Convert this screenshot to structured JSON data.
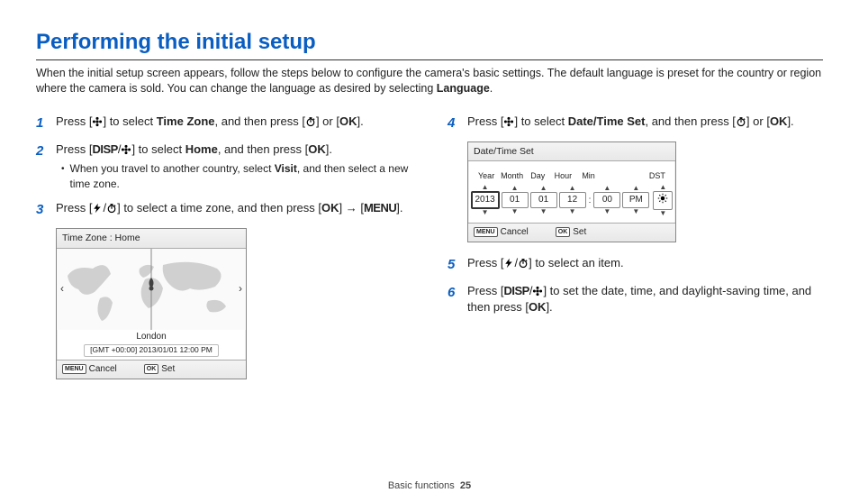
{
  "title": "Performing the initial setup",
  "intro_a": "When the initial setup screen appears, follow the steps below to configure the camera's basic settings. The default language is preset for the country or region where the camera is sold. You can change the language as desired by selecting ",
  "intro_bold": "Language",
  "step1": {
    "n": "1",
    "a": "Press [",
    "b": "] to select ",
    "bold": "Time Zone",
    "c": ", and then press [",
    "d": "] or [",
    "e": "]."
  },
  "step2": {
    "n": "2",
    "a": "Press [",
    "b": "] to select ",
    "bold": "Home",
    "c": ", and then press [",
    "d": "].",
    "sub_a": "When you travel to another country, select ",
    "sub_bold": "Visit",
    "sub_b": ", and then select a new time zone."
  },
  "step3": {
    "n": "3",
    "a": "Press [",
    "b": "] to select a time zone, and then press [",
    "c": "] → [",
    "d": "]."
  },
  "step4": {
    "n": "4",
    "a": "Press [",
    "b": "] to select ",
    "bold": "Date/Time Set",
    "c": ", and then press [",
    "d": "] or [",
    "e": "]."
  },
  "step5": {
    "n": "5",
    "a": "Press [",
    "b": "] to select an item."
  },
  "step6": {
    "n": "6",
    "a": "Press [",
    "b": "] to set the date, time, and daylight-saving time, and then press [",
    "c": "]."
  },
  "tz_panel": {
    "title": "Time Zone : Home",
    "city": "London",
    "gmt": "[GMT +00:00] 2013/01/01 12:00 PM",
    "cancel": "Cancel",
    "set": "Set",
    "menu_key": "MENU",
    "ok_key": "OK"
  },
  "dt_panel": {
    "title": "Date/Time Set",
    "labels": {
      "year": "Year",
      "month": "Month",
      "day": "Day",
      "hour": "Hour",
      "min": "Min",
      "dst": "DST"
    },
    "values": {
      "year": "2013",
      "month": "01",
      "day": "01",
      "hour": "12",
      "min": "00",
      "ampm": "PM"
    },
    "cancel": "Cancel",
    "set": "Set",
    "menu_key": "MENU",
    "ok_key": "OK"
  },
  "glyph": {
    "ok": "OK",
    "menu": "MENU",
    "disp": "DISP"
  },
  "footer": {
    "section": "Basic functions",
    "page": "25"
  }
}
